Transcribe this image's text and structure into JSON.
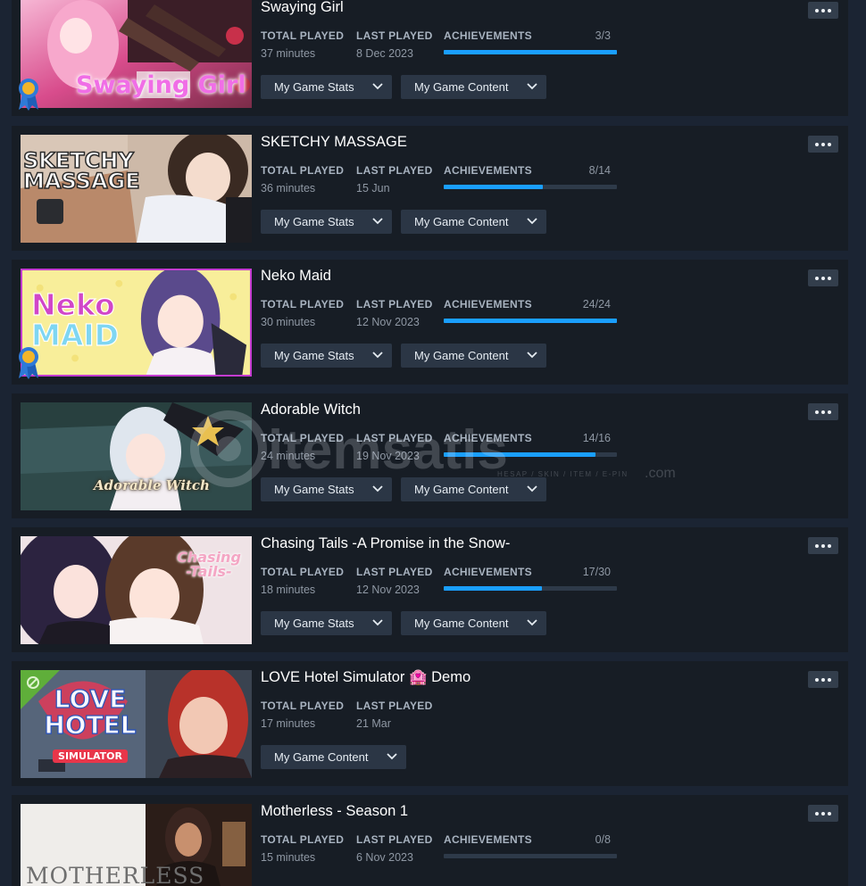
{
  "labels": {
    "total_played": "TOTAL PLAYED",
    "last_played": "LAST PLAYED",
    "achievements": "ACHIEVEMENTS",
    "stats_button": "My Game Stats",
    "content_button": "My Game Content"
  },
  "games": [
    {
      "title": "Swaying Girl",
      "capsule_text": "Swaying Girl",
      "total_played": "37 minutes",
      "last_played": "8 Dec 2023",
      "achievements": "3/3",
      "progress": 1.0,
      "badge": "award-ribbon-icon"
    },
    {
      "title": "SKETCHY MASSAGE",
      "capsule_text": "SKETCHY MASSAGE",
      "total_played": "36 minutes",
      "last_played": "15 Jun",
      "achievements": "8/14",
      "progress": 0.571
    },
    {
      "title": "Neko Maid",
      "capsule_text": "Neko MAID",
      "total_played": "30 minutes",
      "last_played": "12 Nov 2023",
      "achievements": "24/24",
      "progress": 1.0,
      "badge": "award-ribbon-icon"
    },
    {
      "title": "Adorable Witch",
      "capsule_text": "Adorable Witch",
      "total_played": "24 minutes",
      "last_played": "19 Nov 2023",
      "achievements": "14/16",
      "progress": 0.875
    },
    {
      "title": "Chasing Tails -A Promise in the Snow-",
      "capsule_text": "Chasing Tails",
      "total_played": "18 minutes",
      "last_played": "12 Nov 2023",
      "achievements": "17/30",
      "progress": 0.567
    },
    {
      "title": "LOVE Hotel Simulator 🏩 Demo",
      "capsule_text": "LOVE HOTEL SIMULATOR",
      "total_played": "17 minutes",
      "last_played": "21 Mar",
      "store_tag": "demo-wrench-icon"
    },
    {
      "title": "Motherless - Season 1",
      "capsule_text": "MOTHERLESS",
      "total_played": "15 minutes",
      "last_played": "6 Nov 2023",
      "achievements": "0/8",
      "progress": 0.0
    }
  ],
  "watermark": {
    "brand": "itemsatis",
    "tld": ".com",
    "tagline": "HESAP / SKIN / ITEM / E-PIN"
  },
  "colors": {
    "page_bg": "#1b2433",
    "card_bg": "#171d25",
    "progress_fill": "#1a9fff",
    "progress_track": "#2e3a49",
    "button_bg": "#2b3645"
  }
}
